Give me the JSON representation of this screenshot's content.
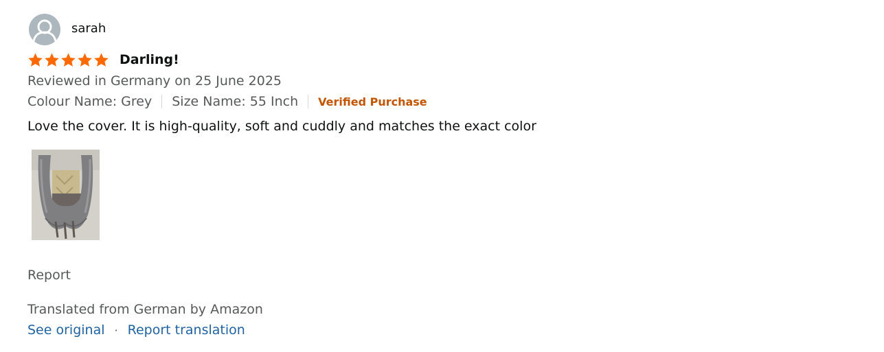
{
  "review": {
    "author": "sarah",
    "avatar_icon": "user-silhouette-icon",
    "rating": 5,
    "rating_max": 5,
    "star_color": "#ff6a00",
    "title": "Darling!",
    "date_line": "Reviewed in Germany on 25 June 2025",
    "variant": {
      "colour": "Colour Name: Grey",
      "size": "Size Name: 55 Inch"
    },
    "badge": "Verified Purchase",
    "badge_color": "#c45500",
    "body": "Love the cover. It is high-quality, soft and cuddly and matches the exact color",
    "report_label": "Report",
    "translation_note": "Translated from German by Amazon",
    "see_original_label": "See original",
    "separator": "·",
    "report_translation_label": "Report translation",
    "link_color": "#2162a1"
  }
}
